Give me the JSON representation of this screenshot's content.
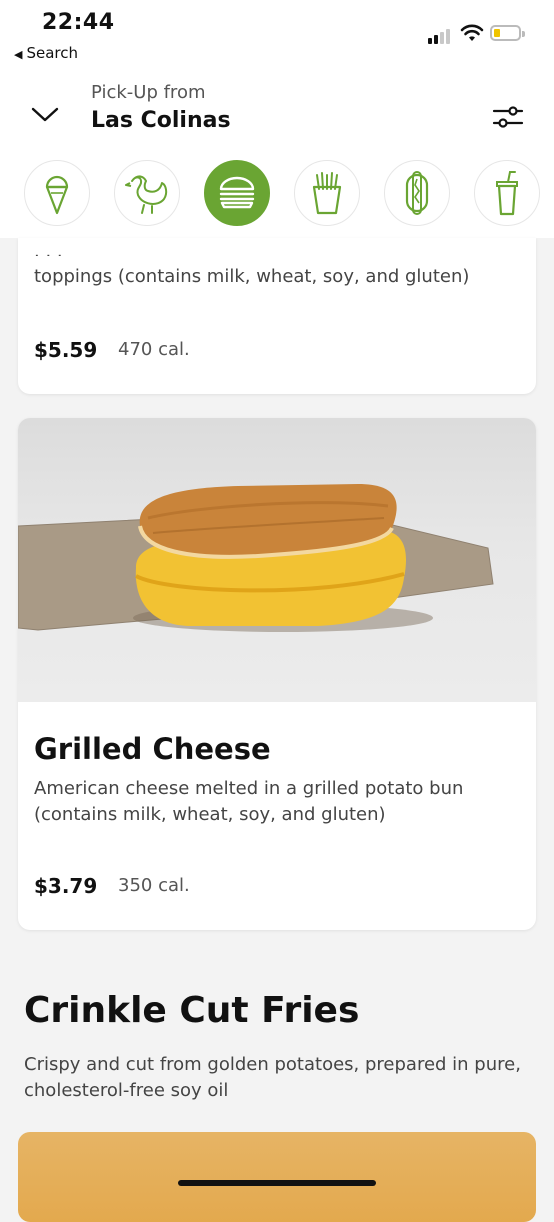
{
  "status_bar": {
    "time": "22:44",
    "back_label": "Search"
  },
  "header": {
    "pickup_label": "Pick-Up from",
    "location": "Las Colinas"
  },
  "categories": [
    {
      "icon": "ice-cream-icon",
      "active": false
    },
    {
      "icon": "chicken-icon",
      "active": false
    },
    {
      "icon": "burger-icon",
      "active": true
    },
    {
      "icon": "fries-icon",
      "active": false
    },
    {
      "icon": "hot-dog-icon",
      "active": false
    },
    {
      "icon": "drink-icon",
      "active": false
    }
  ],
  "card_prev": {
    "description_tail": "toppings (contains milk, wheat, soy, and gluten)",
    "price": "$5.59",
    "calories": "470 cal."
  },
  "card_grilled": {
    "name": "Grilled Cheese",
    "description": "American cheese melted in a grilled potato bun (contains milk, wheat, soy, and gluten)",
    "price": "$3.79",
    "calories": "350 cal."
  },
  "section": {
    "title": "Crinkle Cut Fries",
    "description": "Crispy and cut from golden potatoes, prepared in pure, cholesterol-free soy oil"
  },
  "colors": {
    "accent": "#6aa533",
    "background": "#f3f3f3"
  }
}
